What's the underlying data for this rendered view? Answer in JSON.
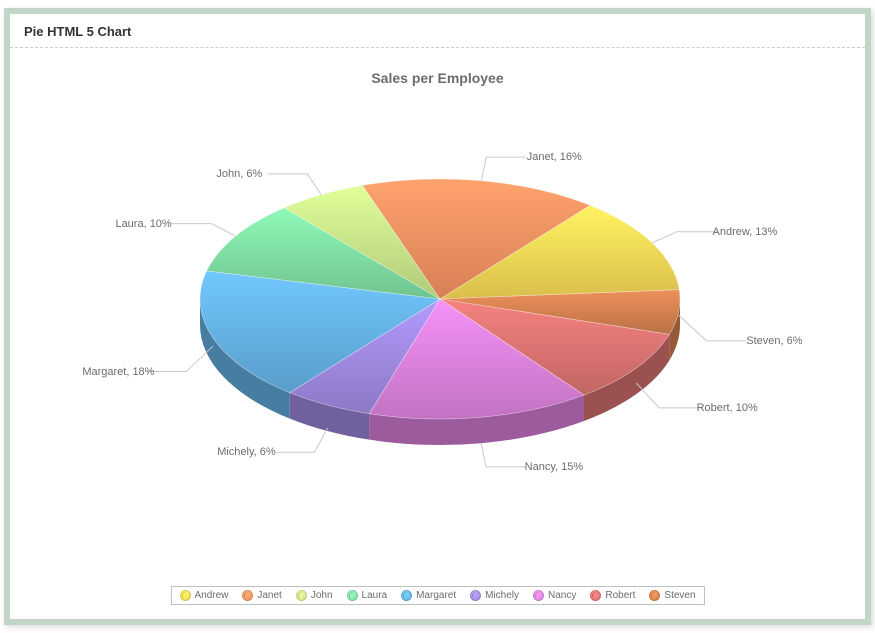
{
  "header": {
    "title": "Pie HTML 5 Chart"
  },
  "chart_data": {
    "type": "pie",
    "title": "Sales per Employee",
    "style": "3d",
    "series": [
      {
        "name": "Andrew",
        "value": 13,
        "color": "#f2d354"
      },
      {
        "name": "Janet",
        "value": 16,
        "color": "#ef8e5f"
      },
      {
        "name": "John",
        "value": 6,
        "color": "#c3e086"
      },
      {
        "name": "Laura",
        "value": 10,
        "color": "#7cd9a0"
      },
      {
        "name": "Margaret",
        "value": 18,
        "color": "#62aee0"
      },
      {
        "name": "Michely",
        "value": 6,
        "color": "#9c86dc"
      },
      {
        "name": "Nancy",
        "value": 15,
        "color": "#d77fd8"
      },
      {
        "name": "Robert",
        "value": 10,
        "color": "#d6716f"
      },
      {
        "name": "Steven",
        "value": 6,
        "color": "#cf7d4e"
      }
    ],
    "value_suffix": "%",
    "legend_position": "bottom",
    "label_format": "{name}, {value}{suffix}"
  }
}
